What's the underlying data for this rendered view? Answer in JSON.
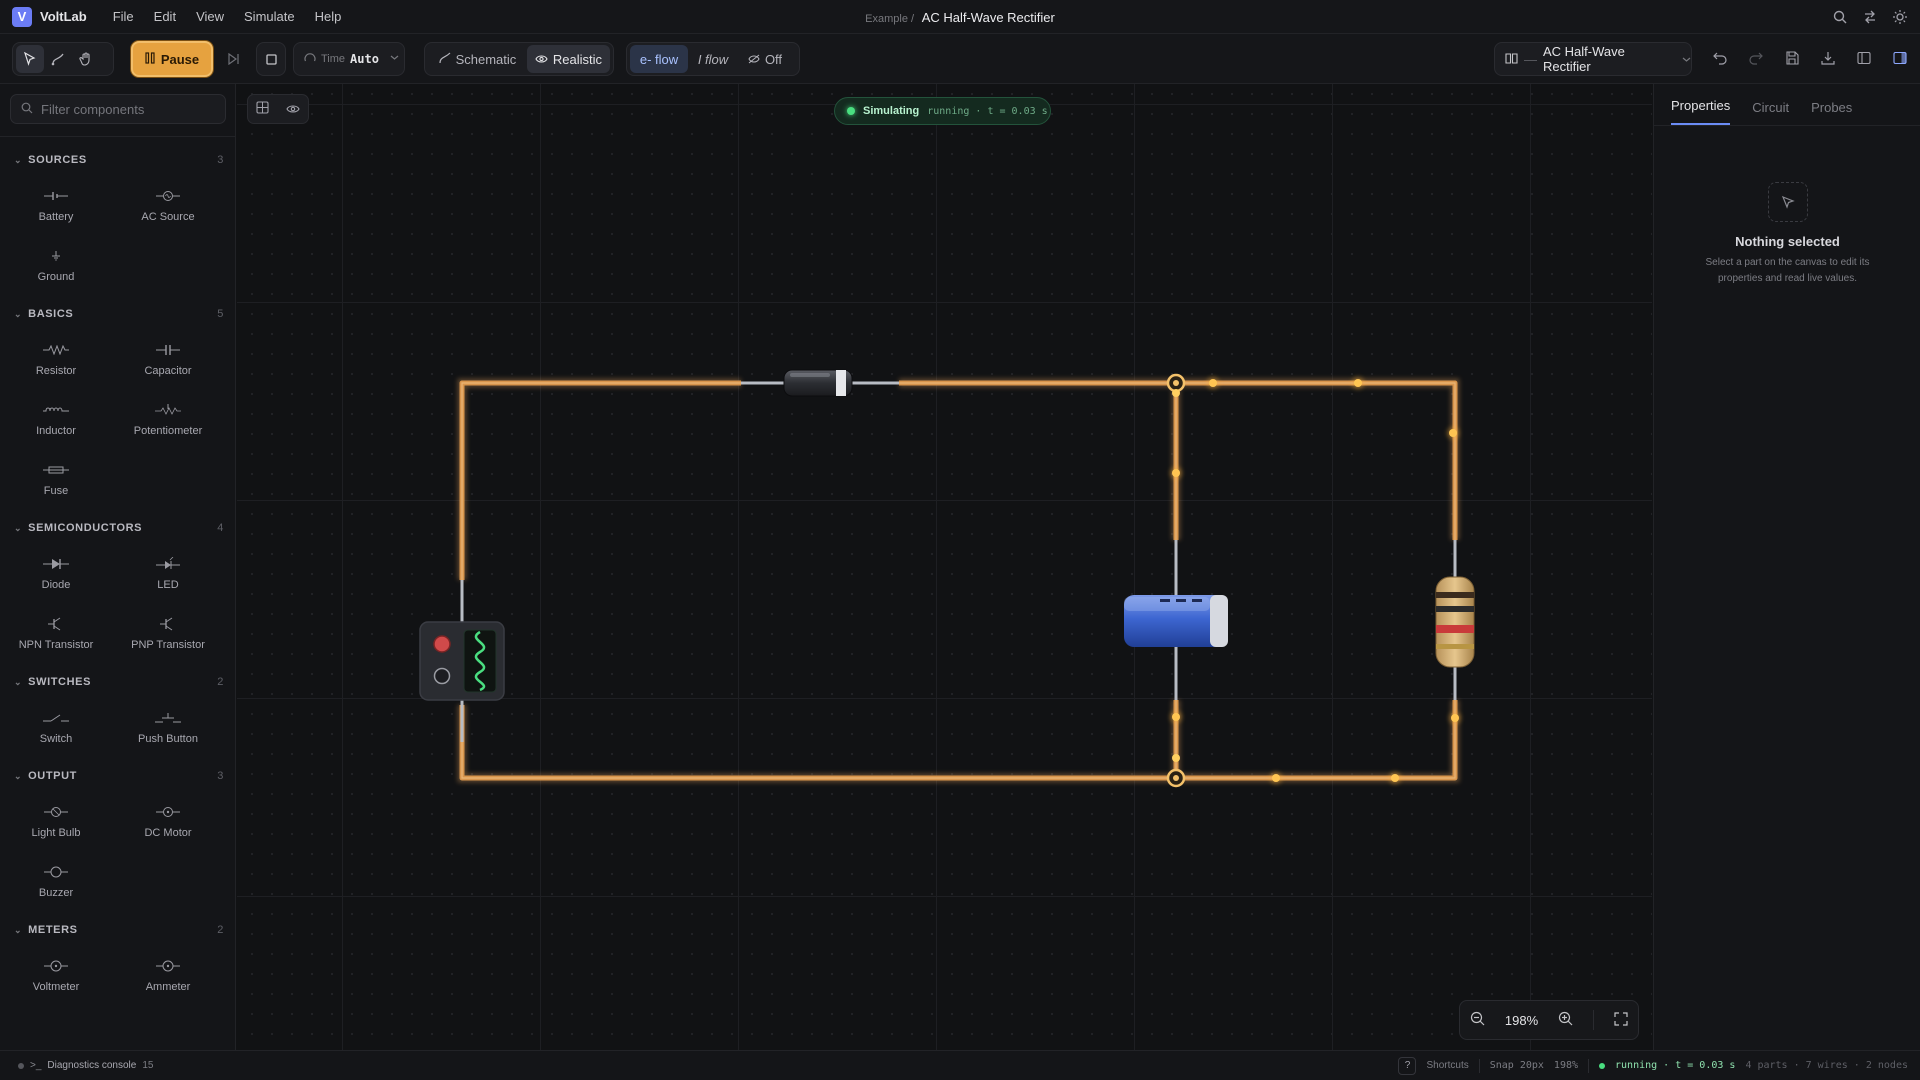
{
  "app": {
    "name": "VoltLab",
    "menus": [
      "File",
      "Edit",
      "View",
      "Simulate",
      "Help"
    ]
  },
  "breadcrumb": {
    "prefix": "Example /",
    "title": "AC Half-Wave Rectifier"
  },
  "toolbar": {
    "pause_label": "Pause",
    "time_label": "Time",
    "time_value": "Auto",
    "view_schematic": "Schematic",
    "view_realistic": "Realistic",
    "active_view": "Realistic",
    "flow_electron": "e- flow",
    "flow_current": "I flow",
    "flow_off": "Off",
    "active_flow": "e- flow",
    "circuit_name": "AC Half-Wave Rectifier"
  },
  "sidebar": {
    "filter_placeholder": "Filter components",
    "sections": [
      {
        "title": "SOURCES",
        "count": "3",
        "items": [
          "Battery",
          "AC Source",
          "Ground"
        ]
      },
      {
        "title": "BASICS",
        "count": "5",
        "items": [
          "Resistor",
          "Capacitor",
          "Inductor",
          "Potentiometer",
          "Fuse"
        ]
      },
      {
        "title": "SEMICONDUCTORS",
        "count": "4",
        "items": [
          "Diode",
          "LED",
          "NPN Transistor",
          "PNP Transistor"
        ]
      },
      {
        "title": "SWITCHES",
        "count": "2",
        "items": [
          "Switch",
          "Push Button"
        ]
      },
      {
        "title": "OUTPUT",
        "count": "3",
        "items": [
          "Light Bulb",
          "DC Motor",
          "Buzzer"
        ]
      },
      {
        "title": "METERS",
        "count": "2",
        "items": [
          "Voltmeter",
          "Ammeter"
        ]
      }
    ]
  },
  "canvas": {
    "sim_status": "Simulating",
    "sim_detail": "running · t = 0.03 s",
    "zoom": "198%"
  },
  "right_panel": {
    "tabs": [
      "Properties",
      "Circuit",
      "Probes"
    ],
    "active_tab": "Properties",
    "empty_title": "Nothing selected",
    "empty_desc": "Select a part on the canvas to edit its properties and read live values."
  },
  "status": {
    "diagnostics_label": "Diagnostics console",
    "diagnostics_count": "15",
    "shortcuts": "Shortcuts",
    "snap": "Snap 20px",
    "zoom": "198%",
    "run": "running · t = 0.03 s",
    "stats": "4 parts · 7 wires · 2 nodes"
  },
  "colors": {
    "accent": "#e6a23f",
    "wire": "#e0a05a",
    "running": "#4ade80",
    "link": "#6b8cf5"
  }
}
